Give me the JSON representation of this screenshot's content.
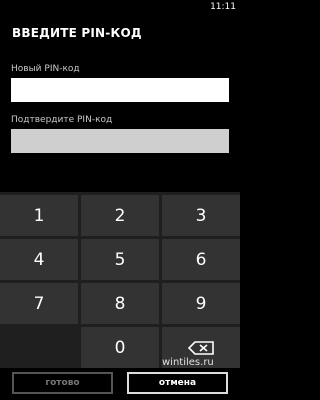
{
  "status": {
    "time": "11:11"
  },
  "title": "ВВЕДИТЕ PIN-КОД",
  "fields": {
    "new_pin_label": "Новый PIN-код",
    "confirm_pin_label": "Подтвердите PIN-код"
  },
  "keypad": {
    "keys": [
      "1",
      "2",
      "3",
      "4",
      "5",
      "6",
      "7",
      "8",
      "9",
      "0"
    ]
  },
  "buttons": {
    "ok": "готово",
    "cancel": "отмена"
  },
  "watermark": "wintiles.ru"
}
